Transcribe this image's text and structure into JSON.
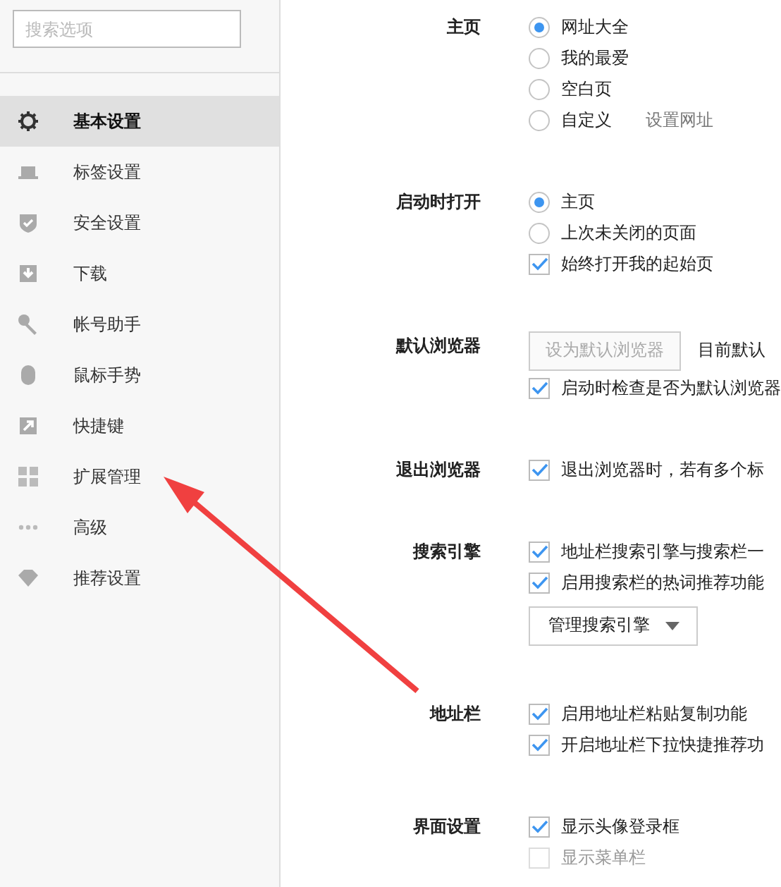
{
  "sidebar": {
    "search": {
      "placeholder": "搜索选项"
    },
    "items": [
      {
        "label": "基本设置",
        "selected": true
      },
      {
        "label": "标签设置",
        "selected": false
      },
      {
        "label": "安全设置",
        "selected": false
      },
      {
        "label": "下载",
        "selected": false
      },
      {
        "label": "帐号助手",
        "selected": false
      },
      {
        "label": "鼠标手势",
        "selected": false
      },
      {
        "label": "快捷键",
        "selected": false
      },
      {
        "label": "扩展管理",
        "selected": false
      },
      {
        "label": "高级",
        "selected": false
      },
      {
        "label": "推荐设置",
        "selected": false
      }
    ]
  },
  "sections": [
    {
      "label": "主页",
      "items": [
        {
          "kind": "radio",
          "label": "网址大全",
          "selected": true
        },
        {
          "kind": "radio",
          "label": "我的最爱",
          "selected": false
        },
        {
          "kind": "radio",
          "label": "空白页",
          "selected": false
        },
        {
          "kind": "radio",
          "label": "自定义",
          "selected": false,
          "link": "设置网址"
        }
      ]
    },
    {
      "label": "启动时打开",
      "items": [
        {
          "kind": "radio",
          "label": "主页",
          "selected": true
        },
        {
          "kind": "radio",
          "label": "上次未关闭的页面",
          "selected": false
        },
        {
          "kind": "checkbox",
          "label": "始终打开我的起始页",
          "checked": true,
          "disabled": false
        }
      ]
    },
    {
      "label": "默认浏览器",
      "items": [
        {
          "kind": "button",
          "label": "设为默认浏览器",
          "disabled": true,
          "note": "目前默认"
        },
        {
          "kind": "checkbox",
          "label": "启动时检查是否为默认浏览器",
          "checked": true,
          "disabled": false
        }
      ]
    },
    {
      "label": "退出浏览器",
      "items": [
        {
          "kind": "checkbox",
          "label": "退出浏览器时，若有多个标",
          "checked": true,
          "disabled": false
        }
      ]
    },
    {
      "label": "搜索引擎",
      "items": [
        {
          "kind": "checkbox",
          "label": "地址栏搜索引擎与搜索栏一",
          "checked": true,
          "disabled": false
        },
        {
          "kind": "checkbox",
          "label": "启用搜索栏的热词推荐功能",
          "checked": true,
          "disabled": false
        },
        {
          "kind": "dropdown",
          "label": "管理搜索引擎"
        }
      ]
    },
    {
      "label": "地址栏",
      "items": [
        {
          "kind": "checkbox",
          "label": "启用地址栏粘贴复制功能",
          "checked": true,
          "disabled": false
        },
        {
          "kind": "checkbox",
          "label": "开启地址栏下拉快捷推荐功",
          "checked": true,
          "disabled": false
        }
      ]
    },
    {
      "label": "界面设置",
      "items": [
        {
          "kind": "checkbox",
          "label": "显示头像登录框",
          "checked": true,
          "disabled": false
        },
        {
          "kind": "checkbox",
          "label": "显示菜单栏",
          "checked": false,
          "disabled": true
        }
      ]
    }
  ]
}
